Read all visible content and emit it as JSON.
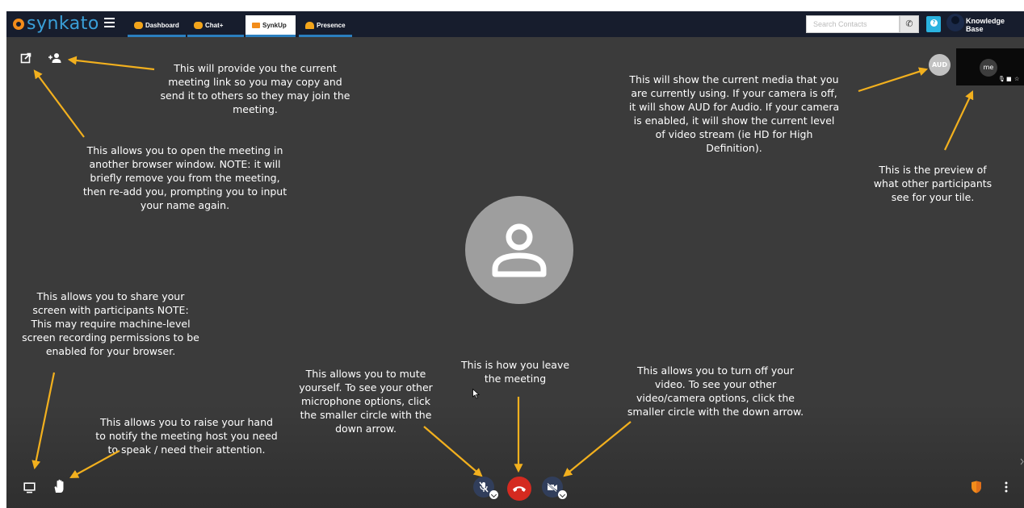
{
  "app": {
    "logo_text": "synkato"
  },
  "nav": {
    "tabs": [
      {
        "label": "Dashboard"
      },
      {
        "label": "Chat+"
      },
      {
        "label": "SynkUp"
      },
      {
        "label": "Presence"
      }
    ],
    "search_placeholder": "Search Contacts",
    "user_name": "Knowledge Base"
  },
  "tiles": {
    "aud_label": "AUD",
    "preview_label": "me"
  },
  "annotations": {
    "meeting_link": "This will provide you the current meeting link so you may copy and send it to others so they may join the meeting.",
    "open_browser": "This allows you to open the meeting in another browser window. NOTE: it will briefly remove you from the meeting, then re-add you, prompting you to input your name again.",
    "media": "This will show the current media that you are currently using. If your camera is off, it will show AUD for Audio. If your camera is enabled, it will show the current level of video stream (ie HD for High Definition).",
    "preview": "This is the preview of what other participants see for your tile.",
    "share_screen": "This allows you to share your screen with participants NOTE: This may require machine-level screen recording permissions to be enabled for your browser.",
    "raise_hand": "This allows you to raise your hand to notify the meeting host you need to speak / need their attention.",
    "mute": "This allows you to mute yourself. To see your other microphone options, click the smaller circle with the down arrow.",
    "leave": "This is how you leave the meeting",
    "video": "This allows you to turn off your video. To see your other video/camera options, click the smaller circle with the down arrow."
  },
  "colors": {
    "accent_orange": "#f28c1a",
    "topbar_bg": "#171d2d",
    "hangup_red": "#d42a20",
    "arrow": "#f2b01e"
  }
}
